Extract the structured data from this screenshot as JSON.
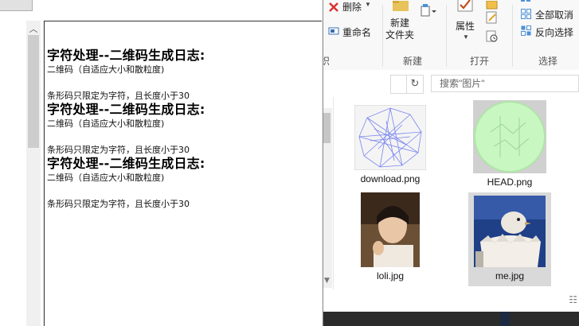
{
  "explorer": {
    "ribbon": {
      "delete_label": "删除",
      "rename_label": "重命名",
      "new_folder_label_1": "新建",
      "new_folder_label_2": "文件夹",
      "group_new": "新建",
      "properties_label": "属性",
      "group_open": "打开",
      "select_all_label": "全部取消",
      "invert_selection_label": "反向选择",
      "group_select": "选择",
      "group_org_partial": "织"
    },
    "search_placeholder": "搜索\"图片\"",
    "files": [
      {
        "name": "download.png"
      },
      {
        "name": "HEAD.png"
      },
      {
        "name": "loli.jpg"
      },
      {
        "name": "me.jpg"
      }
    ]
  },
  "viewer": {
    "log": [
      {
        "title": "字符处理--二维码生成日志:",
        "line": "二维码（自适应大小和散粒度)",
        "tail": "条形码只限定为字符，且长度小于30"
      },
      {
        "title": "字符处理--二维码生成日志:",
        "line": "二维码（自适应大小和散粒度)",
        "tail": "条形码只限定为字符，且长度小于30"
      },
      {
        "title": "字符处理--二维码生成日志:",
        "line": "二维码（自适应大小和散粒度)",
        "tail": "条形码只限定为字符，且长度小于30"
      }
    ]
  },
  "colors": {
    "ribbon_bg": "#f8f8f8",
    "selected_bg": "#d9d9d9",
    "delete_icon": "#d9302c",
    "property_check": "#c24a1d"
  }
}
